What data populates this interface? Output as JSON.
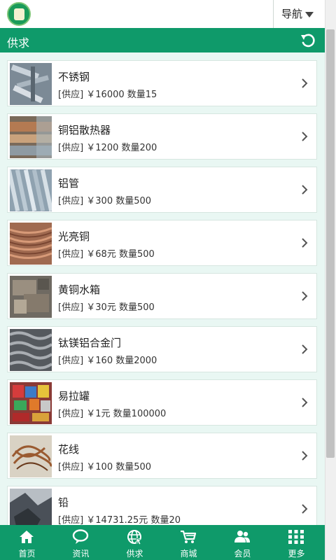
{
  "header": {
    "nav_label": "导航"
  },
  "titlebar": {
    "title": "供求"
  },
  "items": [
    {
      "name": "不锈钢",
      "meta": "[供应] ￥16000 数量15"
    },
    {
      "name": "铜铝散热器",
      "meta": "[供应] ￥1200 数量200"
    },
    {
      "name": "铝管",
      "meta": "[供应] ￥300 数量500"
    },
    {
      "name": "光亮铜",
      "meta": "[供应] ￥68元 数量500"
    },
    {
      "name": "黄铜水箱",
      "meta": "[供应] ￥30元 数量500"
    },
    {
      "name": "钛镁铝合金门",
      "meta": "[供应] ￥160 数量2000"
    },
    {
      "name": "易拉罐",
      "meta": "[供应] ￥1元 数量100000"
    },
    {
      "name": "花线",
      "meta": "[供应] ￥100 数量500"
    },
    {
      "name": "铅",
      "meta": "[供应] ￥14731.25元 数量20"
    }
  ],
  "tabs": [
    {
      "label": "首页",
      "icon": "home-icon"
    },
    {
      "label": "资讯",
      "icon": "chat-bubble-icon"
    },
    {
      "label": "供求",
      "icon": "globe-icon"
    },
    {
      "label": "商城",
      "icon": "cart-icon"
    },
    {
      "label": "会员",
      "icon": "users-icon"
    },
    {
      "label": "更多",
      "icon": "grid-icon"
    }
  ],
  "colors": {
    "primary": "#0f9a6a",
    "background": "#e9f7f3"
  }
}
